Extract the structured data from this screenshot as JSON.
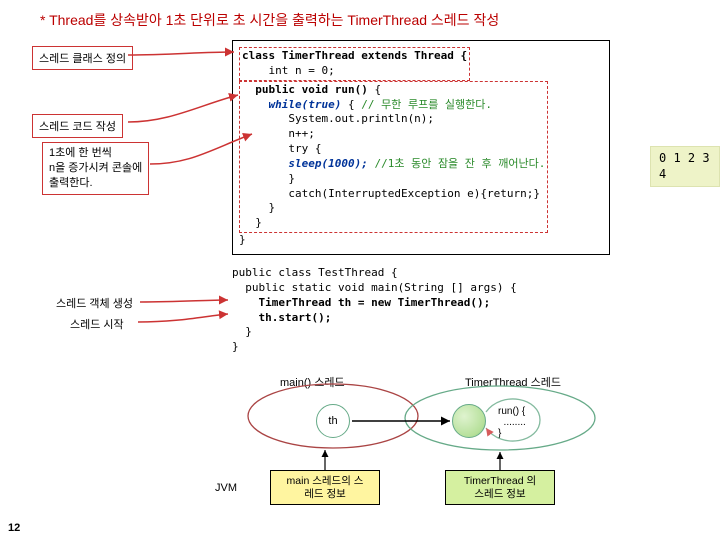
{
  "title": "* Thread를 상속받아 1초 단위로 초 시간을 출력하는 TimerThread 스레드 작성",
  "labels": {
    "classDef": "스레드 클래스 정의",
    "codeWrite": "스레드 코드 작성",
    "note": "1초에 한 번씩\nn을 증가시켜 콘솔에\n출력한다.",
    "objCreate": "스레드 객체 생성",
    "start": "스레드 시작"
  },
  "code1": {
    "l1": "class TimerThread extends Thread {",
    "l2": "    int n = 0;",
    "l3a": "  public void run()",
    "l3b": " {",
    "l4a": "    while(true)",
    "l4b": " { ",
    "l4c": "// 무한 루프를 실행한다.",
    "l5": "       System.out.println(n);",
    "l6": "       n++;",
    "l7": "       try {",
    "l8a": "       sleep(1000);",
    "l8b": " //1초 동안 잠을 잔 후 깨어난다.",
    "l9": "       }",
    "l10": "       catch(InterruptedException e){return;}",
    "l11": "    }",
    "l12": "  }",
    "l13": "}"
  },
  "code2": {
    "l1": "public class TestThread {",
    "l2": "  public static void main(String [] args) {",
    "l3": "    TimerThread th = new TimerThread();",
    "l4": "    th.start();",
    "l5": "  }",
    "l6": "}"
  },
  "output": "0\n1\n2\n3\n4",
  "diag": {
    "mainThread": "main() 스레드",
    "timerThread": "TimerThread 스레드",
    "run1": "run() {",
    "runDots": "  ........",
    "run2": "}",
    "th": "th",
    "jvm": "JVM",
    "mainInfo": "main 스레드의 스\n레드 정보",
    "timerInfo": "TimerThread 의\n스레드 정보"
  },
  "pagenum": "12"
}
